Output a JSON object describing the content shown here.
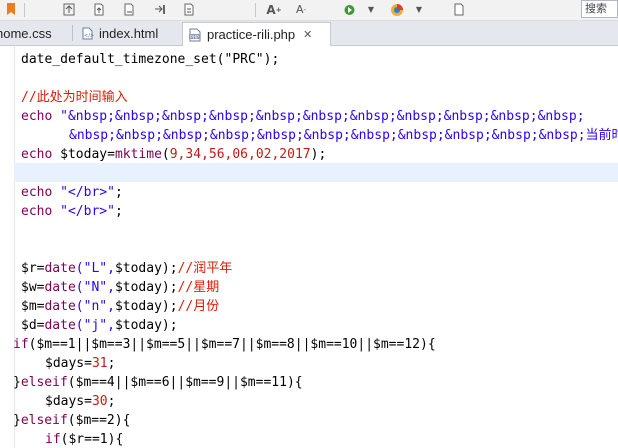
{
  "search": {
    "placeholder": "搜索"
  },
  "tabs": [
    {
      "label": "home.css",
      "type": "css",
      "active": false
    },
    {
      "label": "index.html",
      "type": "html",
      "active": false
    },
    {
      "label": "practice-rili.php",
      "type": "php",
      "active": true
    }
  ],
  "tab_close_symbol": "✕",
  "toolbar_icons": [
    "bookmark-icon",
    "upload-icon",
    "page-icon",
    "page-icon",
    "forward-icon",
    "page-icon",
    "font-increase-icon",
    "font-decrease-icon",
    "run-icon",
    "dropdown-icon",
    "browser-icon",
    "dropdown-icon",
    "page-icon"
  ],
  "code": {
    "line1": "date_default_timezone_set(\"PRC\");",
    "line2_comment": "//此处为时间输入",
    "line3_echo": "echo",
    "line3_str": "\"&nbsp;&nbsp;&nbsp;&nbsp;&nbsp;&nbsp;&nbsp;&nbsp;&nbsp;&nbsp;&nbsp;",
    "line4_str": "&nbsp;&nbsp;&nbsp;&nbsp;&nbsp;&nbsp;&nbsp;&nbsp;&nbsp;&nbsp;&nbsp;当前时间戳",
    "line5_a": "echo ",
    "line5_b": "$today=",
    "line5_c": "mktime",
    "line5_d": "(",
    "line5_e": "9,34,56,06,02,2017",
    "line5_f": ");",
    "line7_echo": "echo ",
    "line7_str": "\"</br>\"",
    "line7_end": ";",
    "line8_echo": "echo ",
    "line8_str": "\"</br>\"",
    "line8_end": ";",
    "r_line": {
      "var": "$r=",
      "fn": "date",
      "args1": "(\"L\",",
      "args2": "$today);",
      "comment": "//润平年"
    },
    "w_line": {
      "var": "$w=",
      "fn": "date",
      "args1": "(\"N\",",
      "args2": "$today);",
      "comment": "//星期"
    },
    "m_line": {
      "var": "$m=",
      "fn": "date",
      "args1": "(\"n\",",
      "args2": "$today);",
      "comment": "//月份"
    },
    "d_line": {
      "var": "$d=",
      "fn": "date",
      "args1": "(\"j\",",
      "args2": "$today);",
      "comment": ""
    },
    "if_line": {
      "kw": "if",
      "body": "($m==1||$m==3||$m==5||$m==7||$m==8||$m==10||$m==12){"
    },
    "days31": {
      "var": "$days=",
      "num": "31",
      "end": ";"
    },
    "elseif1": {
      "pre": "}",
      "kw": "elseif",
      "body": "($m==4||$m==6||$m==9||$m==11){"
    },
    "days30": {
      "var": "$days=",
      "num": "30",
      "end": ";"
    },
    "elseif2": {
      "pre": "}",
      "kw": "elseif",
      "body": "($m==2){"
    },
    "if_r": {
      "kw": "if",
      "body": "($r==1){"
    }
  },
  "colors": {
    "keyword": "#2a00ff",
    "comment": "#d81e06",
    "number": "#c41a16",
    "current_line": "#e8f2fe"
  }
}
